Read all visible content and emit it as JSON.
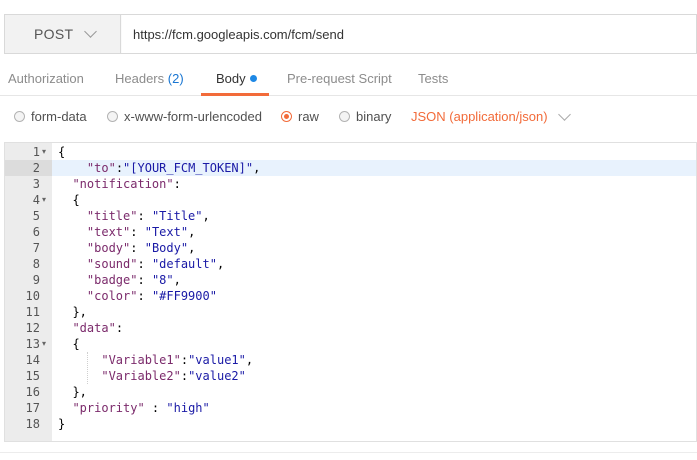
{
  "request": {
    "method": "POST",
    "url": "https://fcm.googleapis.com/fcm/send"
  },
  "tabs": [
    {
      "label": "Authorization"
    },
    {
      "label": "Headers",
      "count": "(2)"
    },
    {
      "label": "Body",
      "active": true,
      "indicator": "dot"
    },
    {
      "label": "Pre-request Script"
    },
    {
      "label": "Tests"
    }
  ],
  "body_types": [
    {
      "label": "form-data",
      "checked": false
    },
    {
      "label": "x-www-form-urlencoded",
      "checked": false
    },
    {
      "label": "raw",
      "checked": true
    },
    {
      "label": "binary",
      "checked": false
    }
  ],
  "content_type": "JSON (application/json)",
  "editor": {
    "active_line": 2,
    "lines": [
      {
        "n": "1",
        "fold": true,
        "indent": 0,
        "tokens": [
          [
            "p",
            "{"
          ]
        ]
      },
      {
        "n": "2",
        "fold": false,
        "indent": 4,
        "tokens": [
          [
            "k",
            "\"to\""
          ],
          [
            "p",
            ":"
          ],
          [
            "s",
            "\"[YOUR_FCM_TOKEN]\""
          ],
          [
            "p",
            ","
          ]
        ]
      },
      {
        "n": "3",
        "fold": false,
        "indent": 2,
        "tokens": [
          [
            "k",
            "\"notification\""
          ],
          [
            "p",
            ":"
          ]
        ]
      },
      {
        "n": "4",
        "fold": true,
        "indent": 2,
        "tokens": [
          [
            "p",
            "{"
          ]
        ]
      },
      {
        "n": "5",
        "fold": false,
        "indent": 4,
        "tokens": [
          [
            "k",
            "\"title\""
          ],
          [
            "p",
            ": "
          ],
          [
            "s",
            "\"Title\""
          ],
          [
            "p",
            ","
          ]
        ]
      },
      {
        "n": "6",
        "fold": false,
        "indent": 4,
        "tokens": [
          [
            "k",
            "\"text\""
          ],
          [
            "p",
            ": "
          ],
          [
            "s",
            "\"Text\""
          ],
          [
            "p",
            ","
          ]
        ]
      },
      {
        "n": "7",
        "fold": false,
        "indent": 4,
        "tokens": [
          [
            "k",
            "\"body\""
          ],
          [
            "p",
            ": "
          ],
          [
            "s",
            "\"Body\""
          ],
          [
            "p",
            ","
          ]
        ]
      },
      {
        "n": "8",
        "fold": false,
        "indent": 4,
        "tokens": [
          [
            "k",
            "\"sound\""
          ],
          [
            "p",
            ": "
          ],
          [
            "s",
            "\"default\""
          ],
          [
            "p",
            ","
          ]
        ]
      },
      {
        "n": "9",
        "fold": false,
        "indent": 4,
        "tokens": [
          [
            "k",
            "\"badge\""
          ],
          [
            "p",
            ": "
          ],
          [
            "s",
            "\"8\""
          ],
          [
            "p",
            ","
          ]
        ]
      },
      {
        "n": "10",
        "fold": false,
        "indent": 4,
        "tokens": [
          [
            "k",
            "\"color\""
          ],
          [
            "p",
            ": "
          ],
          [
            "s",
            "\"#FF9900\""
          ]
        ]
      },
      {
        "n": "11",
        "fold": false,
        "indent": 2,
        "tokens": [
          [
            "p",
            "},"
          ]
        ]
      },
      {
        "n": "12",
        "fold": false,
        "indent": 2,
        "tokens": [
          [
            "k",
            "\"data\""
          ],
          [
            "p",
            ":"
          ]
        ]
      },
      {
        "n": "13",
        "fold": true,
        "indent": 2,
        "tokens": [
          [
            "p",
            "{"
          ]
        ]
      },
      {
        "n": "14",
        "fold": false,
        "indent": 6,
        "tokens": [
          [
            "k",
            "\"Variable1\""
          ],
          [
            "p",
            ":"
          ],
          [
            "s",
            "\"value1\""
          ],
          [
            "p",
            ","
          ]
        ]
      },
      {
        "n": "15",
        "fold": false,
        "indent": 6,
        "tokens": [
          [
            "k",
            "\"Variable2\""
          ],
          [
            "p",
            ":"
          ],
          [
            "s",
            "\"value2\""
          ]
        ]
      },
      {
        "n": "16",
        "fold": false,
        "indent": 2,
        "tokens": [
          [
            "p",
            "},"
          ]
        ]
      },
      {
        "n": "17",
        "fold": false,
        "indent": 2,
        "tokens": [
          [
            "k",
            "\"priority\""
          ],
          [
            "p",
            " : "
          ],
          [
            "s",
            "\"high\""
          ]
        ]
      },
      {
        "n": "18",
        "fold": false,
        "indent": 0,
        "tokens": [
          [
            "p",
            "}"
          ]
        ]
      }
    ]
  },
  "colors": {
    "accent": "#f26b3a",
    "link_blue": "#1976d2",
    "json_key": "#7b2a6b",
    "json_string": "#1a1aa6"
  },
  "icons": {
    "method_dropdown": "chevron-down-icon",
    "content_type_dropdown": "chevron-down-icon",
    "fold": "fold-arrow-icon",
    "body_indicator": "dot-icon"
  }
}
